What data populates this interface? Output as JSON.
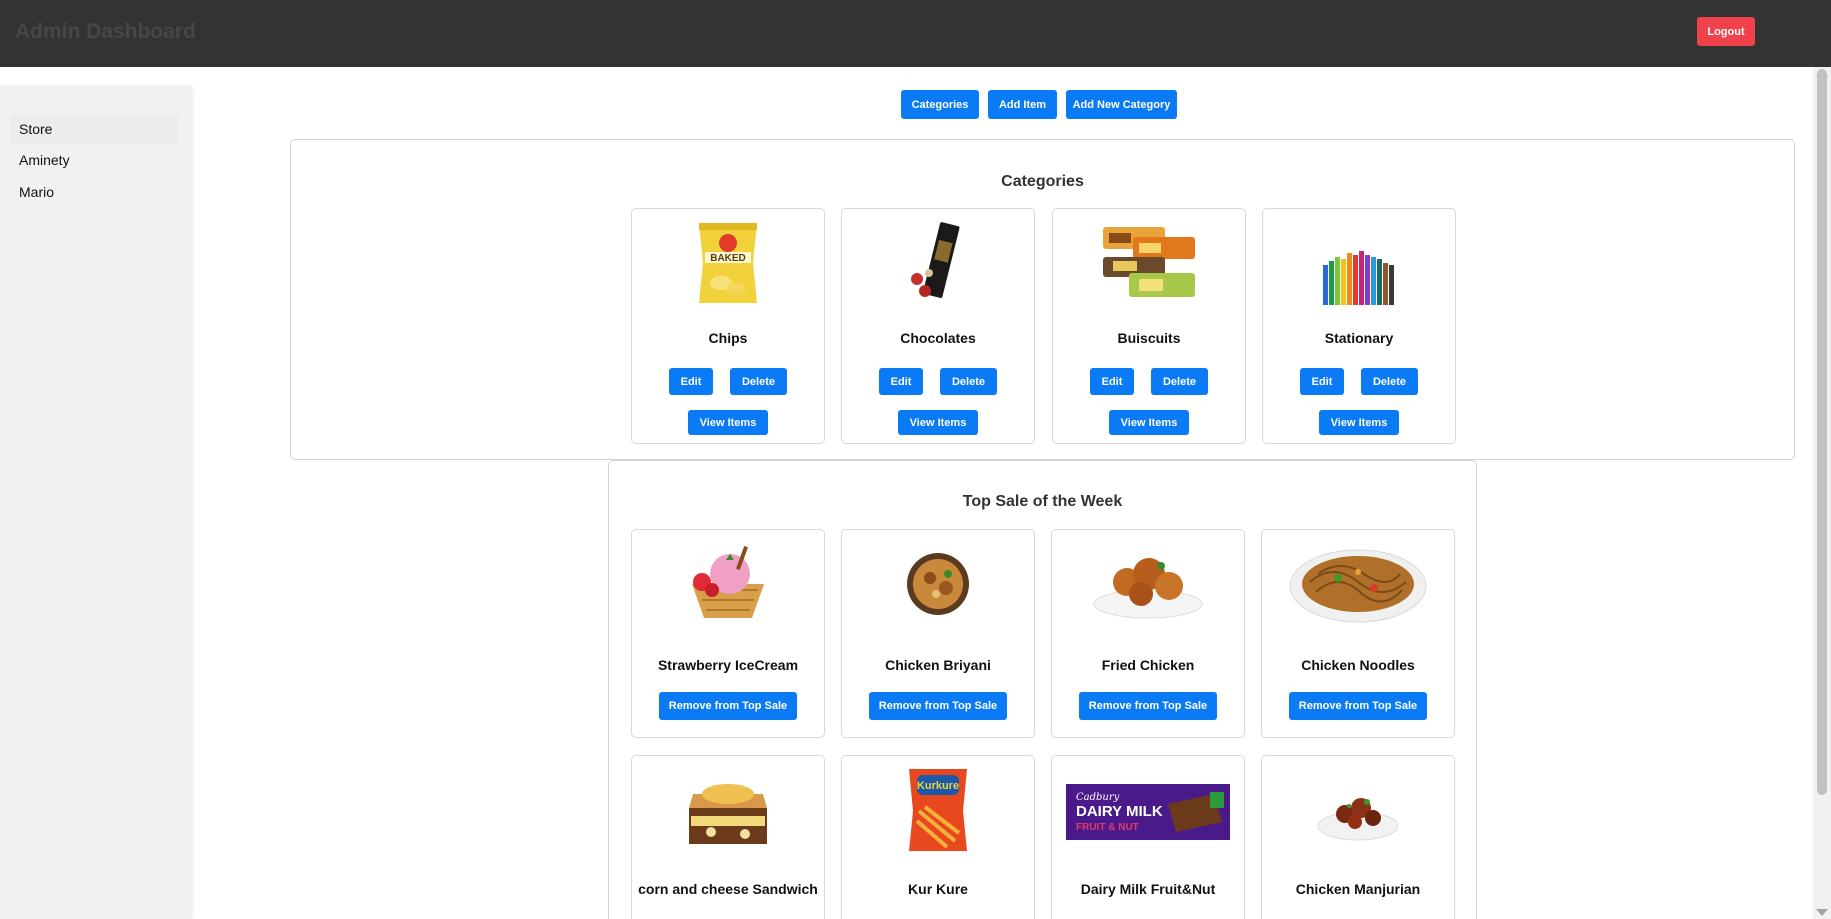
{
  "header": {
    "title": "Admin Dashboard",
    "logout_label": "Logout"
  },
  "sidebar": {
    "items": [
      {
        "label": "Store"
      },
      {
        "label": "Aminety"
      },
      {
        "label": "Mario"
      }
    ]
  },
  "toolbar": {
    "categories_label": "Categories",
    "add_item_label": "Add Item",
    "add_category_label": "Add New Category"
  },
  "categories": {
    "title": "Categories",
    "edit_label": "Edit",
    "delete_label": "Delete",
    "view_label": "View Items",
    "items": [
      {
        "name": "Chips",
        "image": "chips-bag-image"
      },
      {
        "name": "Chocolates",
        "image": "chocolate-box-image"
      },
      {
        "name": "Buiscuits",
        "image": "biscuit-packs-image"
      },
      {
        "name": "Stationary",
        "image": "color-pencils-image"
      }
    ]
  },
  "top_sale": {
    "title": "Top Sale of the Week",
    "remove_label": "Remove from Top Sale",
    "items": [
      {
        "name": "Strawberry IceCream",
        "image": "ice-cream-image"
      },
      {
        "name": "Chicken Briyani",
        "image": "biryani-bowl-image"
      },
      {
        "name": "Fried Chicken",
        "image": "fried-chicken-image"
      },
      {
        "name": "Chicken Noodles",
        "image": "noodles-plate-image"
      },
      {
        "name": "corn and cheese Sandwich",
        "image": "sandwich-image"
      },
      {
        "name": "Kur Kure",
        "image": "kurkure-pack-image"
      },
      {
        "name": "Dairy Milk Fruit&Nut",
        "image": "dairy-milk-bar-image"
      },
      {
        "name": "Chicken Manjurian",
        "image": "manchurian-plate-image"
      }
    ]
  },
  "colors": {
    "header_bg": "#333333",
    "accent": "#0a7bf4",
    "logout": "#f0424a",
    "sidebar_bg": "#f1f1f1"
  }
}
